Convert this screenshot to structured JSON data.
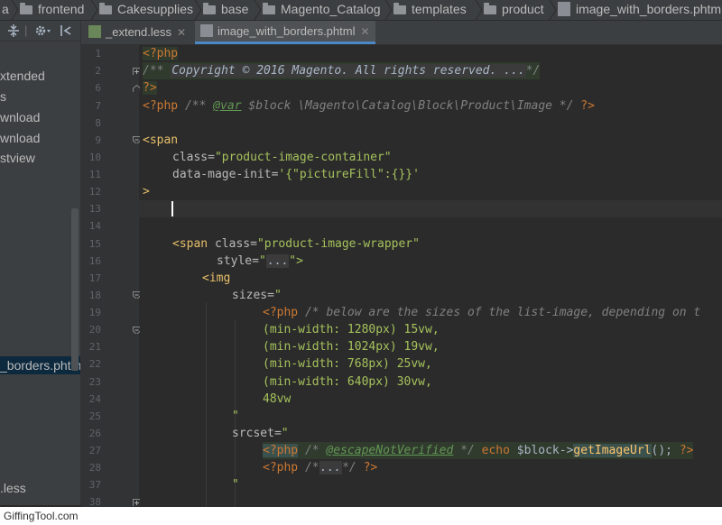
{
  "breadcrumb": {
    "items": [
      {
        "label": "a",
        "icon": "folder-icon"
      },
      {
        "label": "frontend",
        "icon": "folder-icon"
      },
      {
        "label": "Cakesupplies",
        "icon": "folder-icon"
      },
      {
        "label": "base",
        "icon": "folder-icon"
      },
      {
        "label": "Magento_Catalog",
        "icon": "folder-icon"
      },
      {
        "label": "templates",
        "icon": "folder-icon"
      },
      {
        "label": "product",
        "icon": "folder-icon"
      },
      {
        "label": "image_with_borders.phtml",
        "icon": "php-file-icon"
      }
    ]
  },
  "sidebar": {
    "items": [
      {
        "label": "xtended"
      },
      {
        "label": "s"
      },
      {
        "label": "wnload"
      },
      {
        "label": "wnload"
      },
      {
        "label": "stview"
      },
      {
        "label": "_borders.phtml",
        "selected": true
      },
      {
        "label": ".less"
      }
    ]
  },
  "tabs": [
    {
      "label": "_extend.less",
      "icon": "less-file-icon",
      "active": false
    },
    {
      "label": "image_with_borders.phtml",
      "icon": "php-file-icon",
      "active": true
    }
  ],
  "editor": {
    "line_numbers": [
      "1",
      "2",
      "6",
      "7",
      "8",
      "9",
      "10",
      "11",
      "12",
      "13",
      "14",
      "15",
      "16",
      "17",
      "18",
      "19",
      "20",
      "21",
      "22",
      "23",
      "24",
      "25",
      "26",
      "27",
      "28",
      "37",
      "38"
    ],
    "lines": {
      "l1": "<?php",
      "l2a": "/** ",
      "l2b": "Copyright © 2016 Magento. All rights reserved. ...",
      "l2c": "*/",
      "l6": "?>",
      "l7a": "<?php",
      "l7b": " /** ",
      "l7c": "@var",
      "l7d": " $block ",
      "l7e": "\\Magento\\Catalog\\Block\\Product\\Image",
      "l7f": " */ ",
      "l7g": "?>",
      "l9": "<span",
      "l10a": "class=",
      "l10b": "\"product-image-container\"",
      "l11a": "data-mage-init=",
      "l11b": "'{\"pictureFill\":{}}'",
      "l12": ">",
      "l15a": "<span ",
      "l15b": "class=",
      "l15c": "\"product-image-wrapper\"",
      "l16a": "style=",
      "l16b": "\"",
      "l16c": "...",
      "l16d": "\">",
      "l17": "<img",
      "l18a": "sizes=",
      "l18b": "\"",
      "l19a": "<?php",
      "l19b": " /* below are the sizes of the list-image, depending on t",
      "l20": "(min-width: 1280px) 15vw,",
      "l21": "(min-width: 1024px) 19vw,",
      "l22": "(min-width: 768px) 25vw,",
      "l23": "(min-width: 640px) 30vw,",
      "l24": "48vw",
      "l25": "\"",
      "l26a": "srcset=",
      "l26b": "\"",
      "l27a": "<?php",
      "l27b": " /* ",
      "l27c": "@escapeNotVerified",
      "l27d": " */ ",
      "l27e": "echo",
      "l27f": " $block",
      "l27g": "->",
      "l27h": "getImageUrl",
      "l27i": "(); ",
      "l27j": "?>",
      "l28a": "<?php",
      "l28b": " /*",
      "l28c": "...",
      "l28d": "*/ ",
      "l28e": "?>",
      "l37": "\""
    }
  },
  "watermark": "GiffingTool.com",
  "colors": {
    "background": "#2b2b2b",
    "keyword": "#cc7832",
    "tag": "#e8bf6a",
    "string": "#a5c25c",
    "comment": "#808080",
    "selection": "#0d293e",
    "accent": "#4a88c7"
  }
}
